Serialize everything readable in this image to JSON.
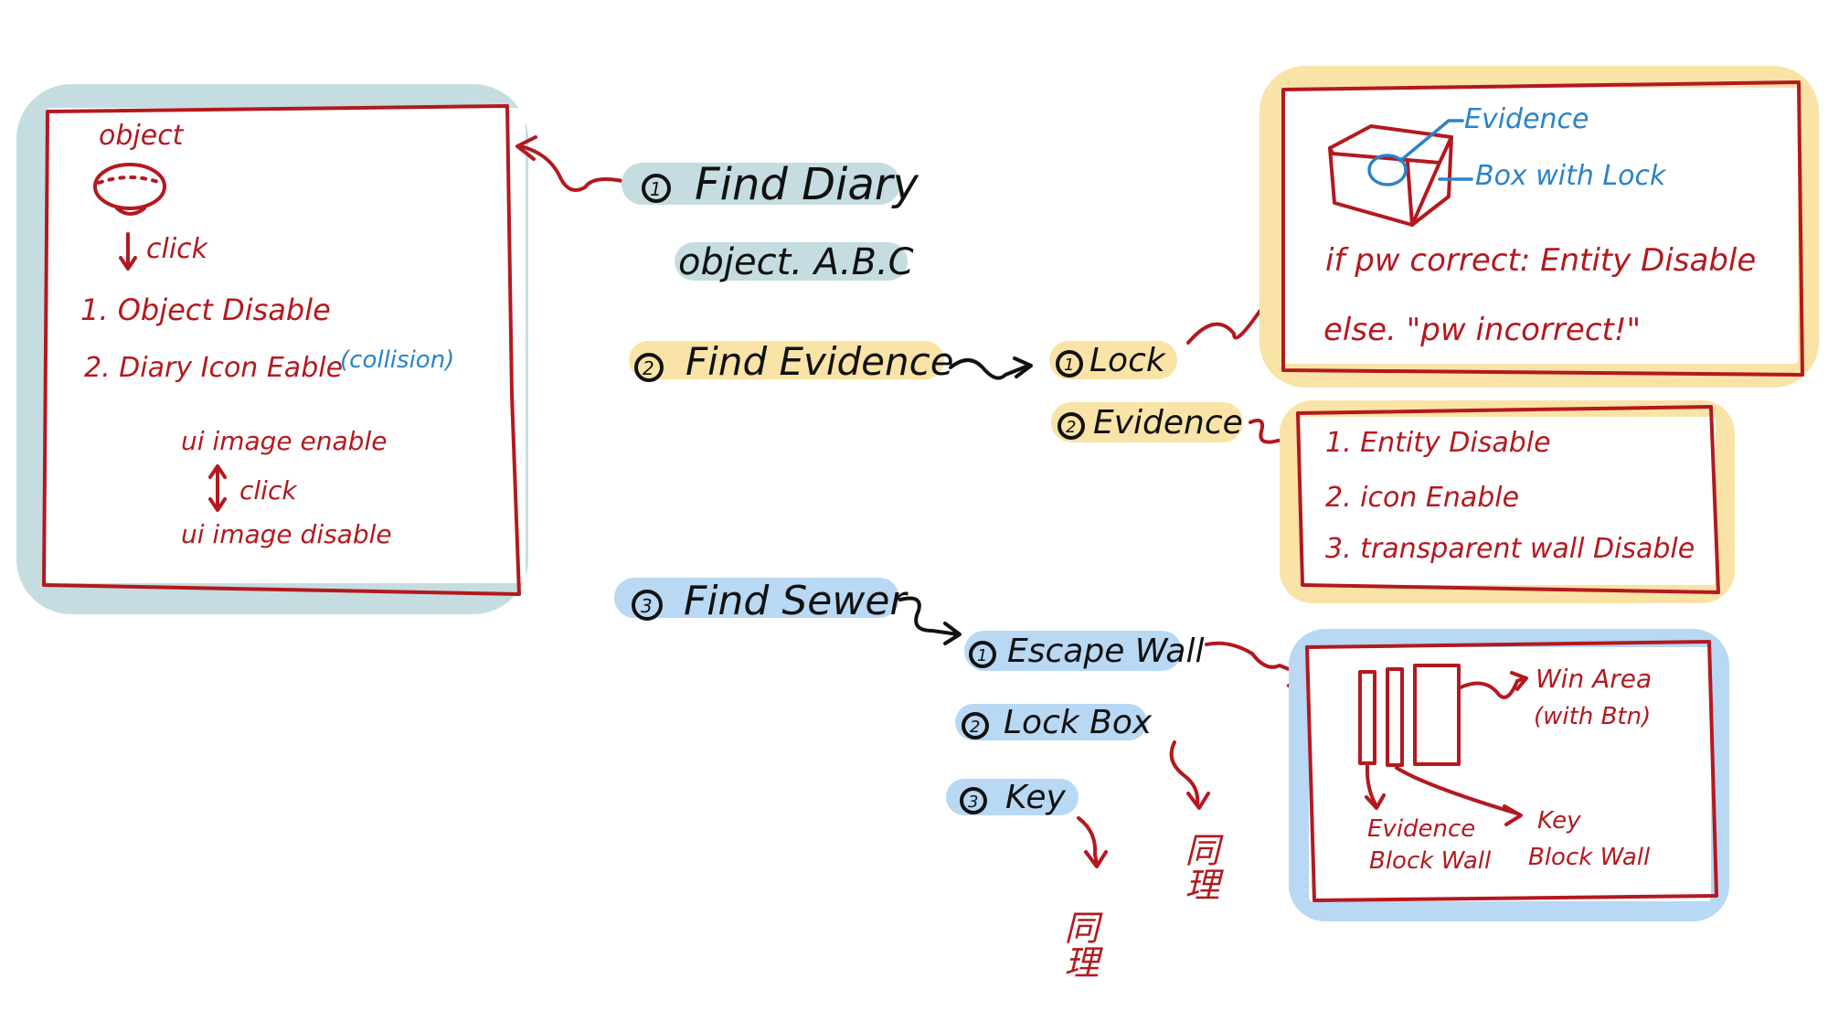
{
  "colors": {
    "ink_red": "#b3191f",
    "ink_black": "#111111",
    "ink_blue": "#2a83c9",
    "teal_highlight": "#c5dde0",
    "yellow_highlight": "#f9e3a6",
    "blue_highlight": "#b8d8f3"
  },
  "left_box": {
    "object_label": "object",
    "click_label": "click",
    "step1": "1. Object Disable",
    "step2": "2. Diary Icon Eable",
    "step2_note": "(collision)",
    "ui_enable": "ui image enable",
    "ui_click": "click",
    "ui_disable": "ui image disable"
  },
  "task1": {
    "title": "Find Diary",
    "subtitle": "object. A.B.C"
  },
  "task2": {
    "title": "Find Evidence",
    "sub1": "Lock",
    "sub2": "Evidence"
  },
  "lock_box": {
    "label_evidence": "Evidence",
    "label_box": "Box with Lock",
    "line1": "if pw correct: Entity Disable",
    "line2": "else. \"pw incorrect!\""
  },
  "evidence_box": {
    "line1": "1. Entity Disable",
    "line2": "2. icon Enable",
    "line3": "3. transparent wall Disable"
  },
  "task3": {
    "title": "Find Sewer",
    "sub1": "Escape Wall",
    "sub2": "Lock Box",
    "sub3": "Key",
    "same_a": "同理",
    "same_b": "同理"
  },
  "escape_box": {
    "win_area": "Win Area",
    "win_note": "(with Btn)",
    "evidence_wall_1": "Evidence",
    "evidence_wall_2": "Block Wall",
    "key_wall_1": "Key",
    "key_wall_2": "Block Wall"
  }
}
